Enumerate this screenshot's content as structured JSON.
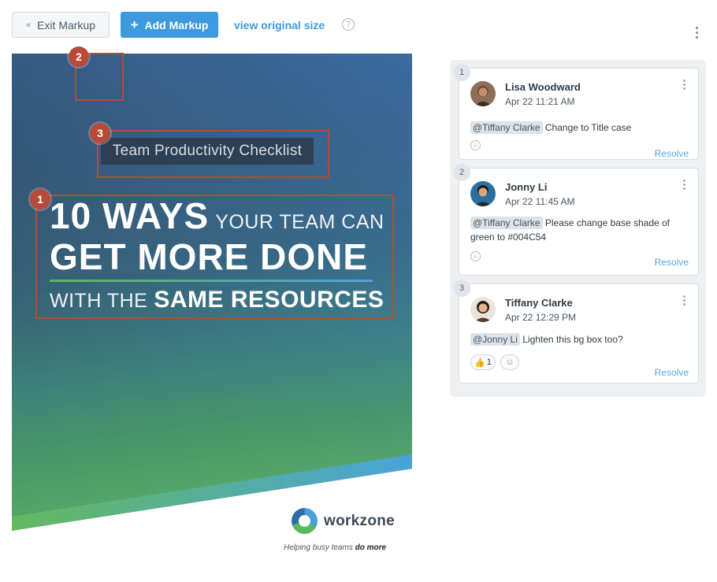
{
  "toolbar": {
    "exit_label": "Exit Markup",
    "exit_icon": "«",
    "add_label": "Add Markup",
    "add_icon": "+",
    "view_original_label": "view original size",
    "help_icon": "?"
  },
  "artwork": {
    "subtitle": "Team Productivity Checklist",
    "headline_big_1": "10 WAYS",
    "headline_small_1": "YOUR TEAM CAN",
    "headline_big_2": "GET MORE DONE",
    "headline_small_3": "WITH THE",
    "headline_bold_3": "SAME RESOURCES",
    "logo_text": "workzone",
    "tagline_plain": "Helping busy teams",
    "tagline_bold": "do more"
  },
  "markups": [
    {
      "number": "1"
    },
    {
      "number": "2"
    },
    {
      "number": "3"
    }
  ],
  "comments": [
    {
      "number": "1",
      "author": "Lisa Woodward",
      "date": "Apr 22 11:21 AM",
      "mention": "@Tiffany Clarke",
      "text": "Change to Title case",
      "resolve": "Resolve"
    },
    {
      "number": "2",
      "author": "Jonny Li",
      "date": "Apr 22 11:45 AM",
      "mention": "@Tiffany Clarke",
      "text": "Please change base shade of green to #004C54",
      "resolve": "Resolve"
    },
    {
      "number": "3",
      "author": "Tiffany Clarke",
      "date": "Apr 22 12:29 PM",
      "mention": "@Jonny Li",
      "text": "Lighten this bg box too?",
      "reaction_emoji": "👍",
      "reaction_count": "1",
      "resolve": "Resolve"
    }
  ],
  "colors": {
    "accent": "#3d9ade",
    "markup_red": "#b84a3a",
    "resolve_blue": "#5da6dd"
  }
}
